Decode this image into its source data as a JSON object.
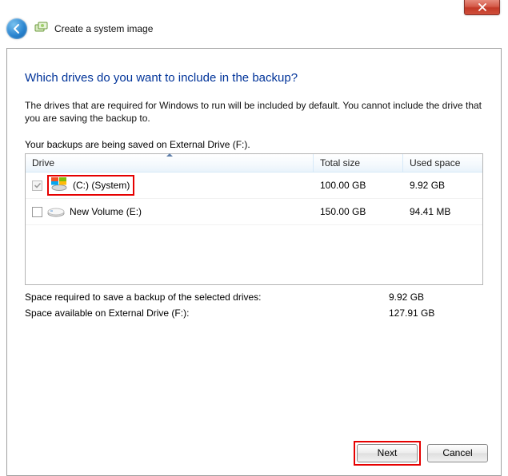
{
  "window": {
    "title": "Create a system image"
  },
  "wizard": {
    "heading": "Which drives do you want to include in the backup?",
    "description": "The drives that are required for Windows to run will be included by default. You cannot include the drive that you are saving the backup to.",
    "saving_to": "Your backups are being saved on External Drive (F:)."
  },
  "table": {
    "headers": {
      "drive": "Drive",
      "total": "Total size",
      "used": "Used space"
    },
    "rows": [
      {
        "checked": true,
        "disabled": true,
        "icon": "win",
        "name": "(C:) (System)",
        "total": "100.00 GB",
        "used": "9.92 GB",
        "highlight": true
      },
      {
        "checked": false,
        "disabled": false,
        "icon": "hdd",
        "name": "New Volume (E:)",
        "total": "150.00 GB",
        "used": "94.41 MB",
        "highlight": false
      }
    ]
  },
  "summary": {
    "required_label": "Space required to save a backup of the selected drives:",
    "required_value": "9.92 GB",
    "available_label": "Space available on External Drive (F:):",
    "available_value": "127.91 GB"
  },
  "buttons": {
    "next": "Next",
    "cancel": "Cancel"
  }
}
